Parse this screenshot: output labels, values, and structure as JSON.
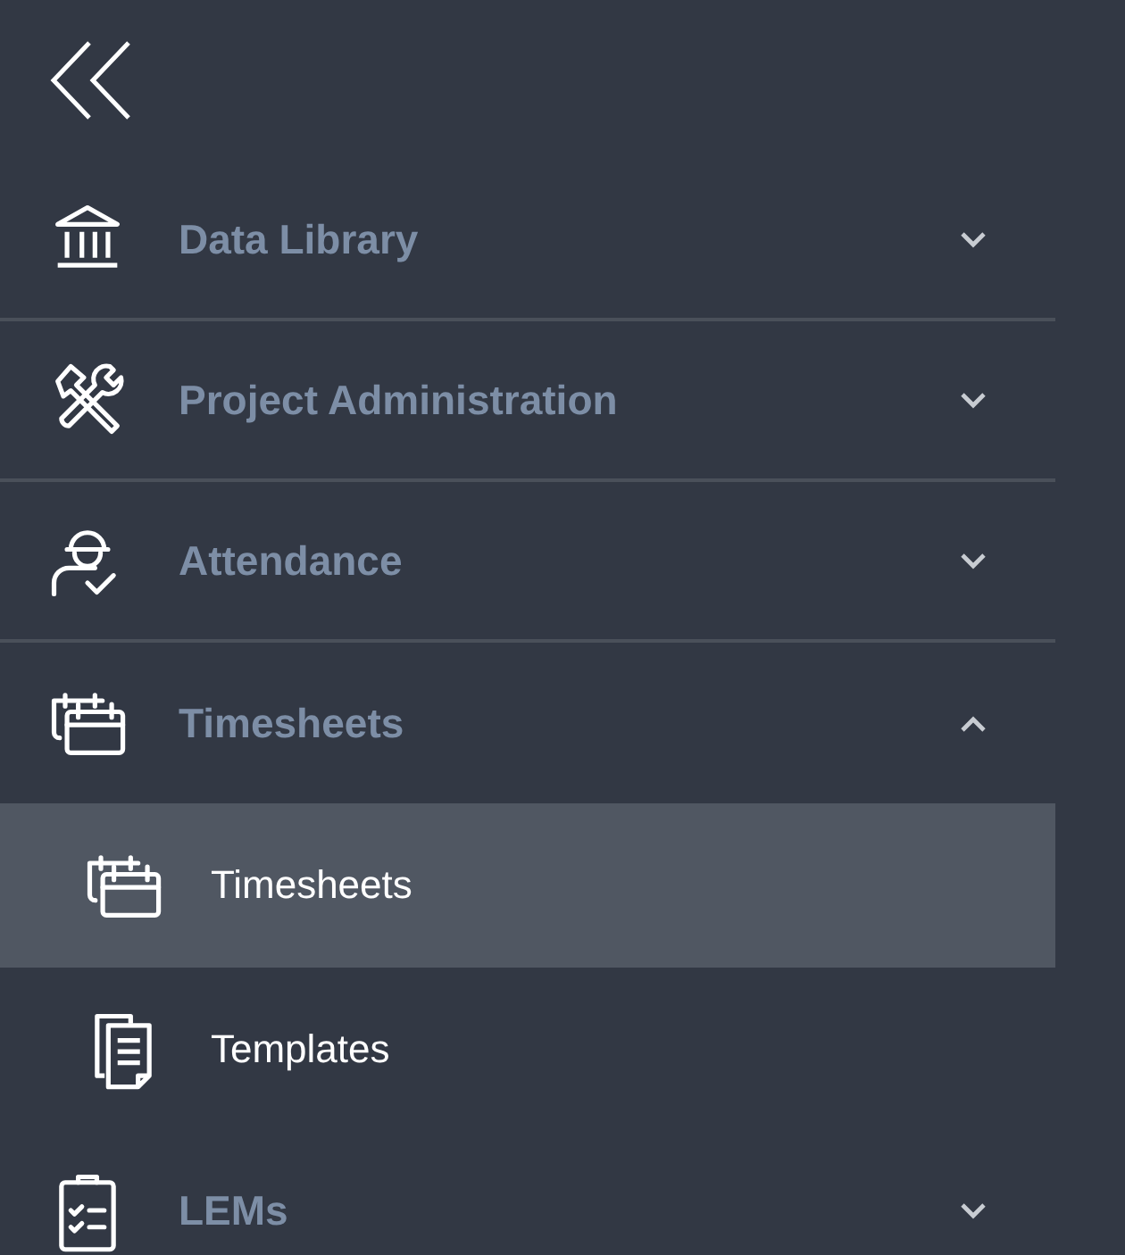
{
  "sidebar": {
    "sections": [
      {
        "label": "Data Library",
        "expanded": false
      },
      {
        "label": "Project Administration",
        "expanded": false
      },
      {
        "label": "Attendance",
        "expanded": false
      },
      {
        "label": "Timesheets",
        "expanded": true,
        "children": [
          {
            "label": "Timesheets",
            "selected": true
          },
          {
            "label": "Templates",
            "selected": false
          }
        ]
      },
      {
        "label": "LEMs",
        "expanded": false
      }
    ]
  }
}
